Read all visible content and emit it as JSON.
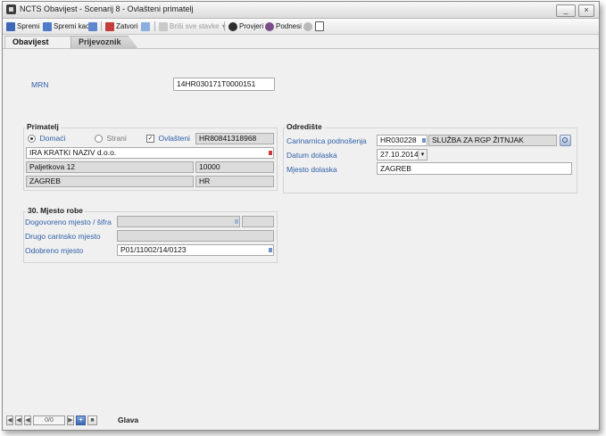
{
  "window": {
    "title": "NCTS Obavijest - Scenarij 8 - Ovlašteni primatelj",
    "min_label": "_",
    "close_label": "×"
  },
  "toolbar": {
    "save": "Spremi",
    "save_as": "Spremi kao",
    "close": "Zatvori",
    "delete_all": "Briši sve stavke",
    "dropdown_glyph": "▾",
    "check": "Provjeri",
    "submit": "Podnesi"
  },
  "tabs": [
    "Obavijest",
    "Prijevoznik"
  ],
  "mrn": {
    "label": "MRN",
    "value": "14HR030171T0000151"
  },
  "primatelj": {
    "title": "Primatelj",
    "radio_domaci": "Domaći",
    "radio_strani": "Strani",
    "check_ovlasteni": "Ovlašteni",
    "check_mark": "✓",
    "id_number": "HR80841318968",
    "name": "IRA KRATKI NAZIV d.o.o.",
    "street": "Paljetkova 12",
    "postcode": "10000",
    "city": "ZAGREB",
    "country": "HR"
  },
  "odrediste": {
    "title": "Odredište",
    "customs_office_label": "Carinarnica podnošenja",
    "customs_office_code": "HR030228",
    "customs_office_name": "SLUŽBA ZA RGP ŽITNJAK",
    "arrival_date_label": "Datum dolaska",
    "arrival_date": "27.10.2014.",
    "arrival_place_label": "Mjesto dolaska",
    "arrival_place": "ZAGREB"
  },
  "mjesto_robe": {
    "title": "30. Mjesto robe",
    "agreed_label": "Dogovoreno mjesto / šifra",
    "other_customs_label": "Drugo carinsko mjesto",
    "approved_label": "Odobreno mjesto",
    "approved_value": "P01/11002/14/0123"
  },
  "navigation": {
    "counter": "0/0",
    "section_label": "Glava",
    "plus": "+"
  },
  "colors": {
    "label_blue": "#2e5fa8",
    "required_marker": "#cc3b3b",
    "lookup_marker": "#6e92c8",
    "readonly_bg": "#dcdcdc"
  }
}
